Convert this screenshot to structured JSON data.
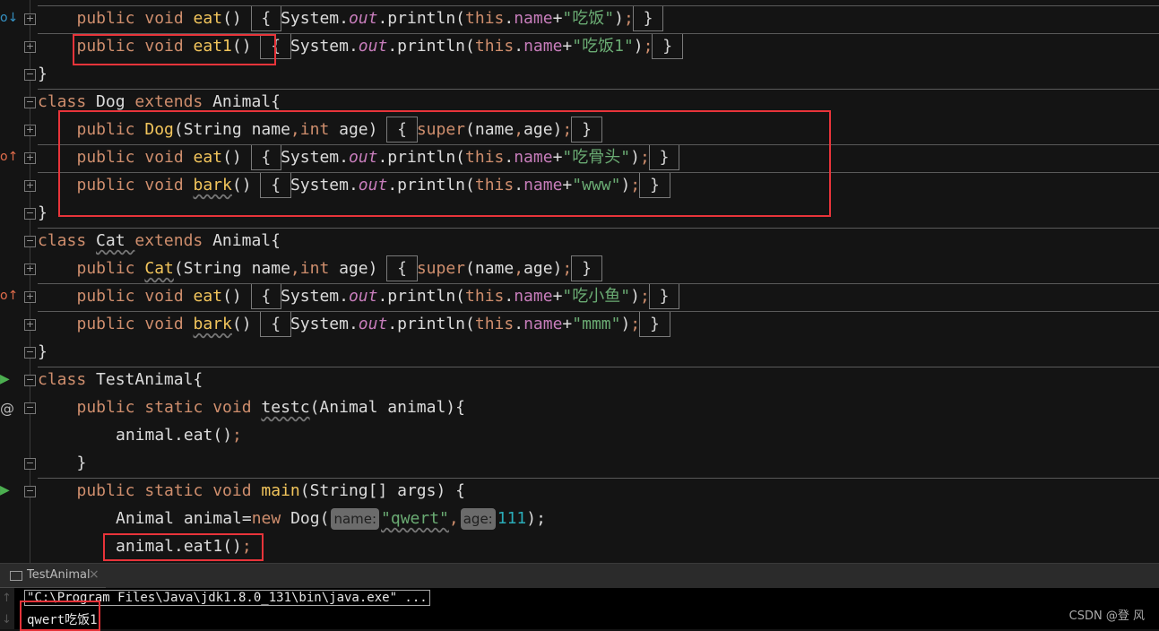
{
  "colors": {
    "accent_red": "#e8343a",
    "background": "#141414"
  },
  "code": {
    "lines": [
      {
        "indent": 1,
        "tokens": [
          [
            "public void ",
            "k"
          ],
          [
            "eat",
            "m"
          ],
          [
            "() ",
            "p"
          ],
          [
            " { ",
            "b"
          ],
          [
            "System.",
            "p"
          ],
          [
            "out",
            "f"
          ],
          [
            ".println(",
            "p"
          ],
          [
            "this",
            "t"
          ],
          [
            ".",
            "p"
          ],
          [
            "name",
            "n"
          ],
          [
            "+",
            "p"
          ],
          [
            "\"吃饭\"",
            "s"
          ],
          [
            ")",
            "p"
          ],
          [
            ";",
            "t"
          ],
          [
            " } ",
            "b"
          ]
        ]
      },
      {
        "indent": 1,
        "tokens": [
          [
            "public void ",
            "k"
          ],
          [
            "eat1",
            "m"
          ],
          [
            "() ",
            "p"
          ],
          [
            " { ",
            "b"
          ],
          [
            "System.",
            "p"
          ],
          [
            "out",
            "f"
          ],
          [
            ".println(",
            "p"
          ],
          [
            "this",
            "t"
          ],
          [
            ".",
            "p"
          ],
          [
            "name",
            "n"
          ],
          [
            "+",
            "p"
          ],
          [
            "\"吃饭1\"",
            "s"
          ],
          [
            ")",
            "p"
          ],
          [
            ";",
            "t"
          ],
          [
            " } ",
            "b"
          ]
        ]
      },
      {
        "indent": 0,
        "tokens": [
          [
            "}",
            "p"
          ]
        ]
      },
      {
        "indent": 0,
        "tokens": [
          [
            "class ",
            "k"
          ],
          [
            "Dog ",
            "p"
          ],
          [
            "extends ",
            "k"
          ],
          [
            "Animal{",
            "p"
          ]
        ]
      },
      {
        "indent": 1,
        "tokens": [
          [
            "public ",
            "k"
          ],
          [
            "Dog",
            "m"
          ],
          [
            "(String name",
            "p"
          ],
          [
            ",",
            "k"
          ],
          [
            "int ",
            "k"
          ],
          [
            "age) ",
            "p"
          ],
          [
            " { ",
            "b"
          ],
          [
            "super",
            "k"
          ],
          [
            "(name",
            "p"
          ],
          [
            ",",
            "k"
          ],
          [
            "age)",
            "p"
          ],
          [
            ";",
            "t"
          ],
          [
            " } ",
            "b"
          ]
        ]
      },
      {
        "indent": 1,
        "tokens": [
          [
            "public void ",
            "k"
          ],
          [
            "eat",
            "m"
          ],
          [
            "() ",
            "p"
          ],
          [
            " { ",
            "b"
          ],
          [
            "System.",
            "p"
          ],
          [
            "out",
            "f"
          ],
          [
            ".println(",
            "p"
          ],
          [
            "this",
            "t"
          ],
          [
            ".",
            "p"
          ],
          [
            "name",
            "n"
          ],
          [
            "+",
            "p"
          ],
          [
            "\"吃骨头\"",
            "s"
          ],
          [
            ")",
            "p"
          ],
          [
            ";",
            "t"
          ],
          [
            " } ",
            "b"
          ]
        ]
      },
      {
        "indent": 1,
        "tokens": [
          [
            "public void ",
            "k"
          ],
          [
            "bark",
            "m u"
          ],
          [
            "() ",
            "p"
          ],
          [
            " { ",
            "b"
          ],
          [
            "System.",
            "p"
          ],
          [
            "out",
            "f"
          ],
          [
            ".println(",
            "p"
          ],
          [
            "this",
            "t"
          ],
          [
            ".",
            "p"
          ],
          [
            "name",
            "n"
          ],
          [
            "+",
            "p"
          ],
          [
            "\"www\"",
            "s"
          ],
          [
            ")",
            "p"
          ],
          [
            ";",
            "t"
          ],
          [
            " } ",
            "b"
          ]
        ]
      },
      {
        "indent": 0,
        "tokens": [
          [
            "}",
            "p"
          ]
        ]
      },
      {
        "indent": 0,
        "tokens": [
          [
            "class ",
            "k"
          ],
          [
            "Cat ",
            "p u"
          ],
          [
            "extends ",
            "k"
          ],
          [
            "Animal{",
            "p"
          ]
        ]
      },
      {
        "indent": 1,
        "tokens": [
          [
            "public ",
            "k"
          ],
          [
            "Cat",
            "m u"
          ],
          [
            "(String name",
            "p"
          ],
          [
            ",",
            "k"
          ],
          [
            "int ",
            "k"
          ],
          [
            "age) ",
            "p"
          ],
          [
            " { ",
            "b"
          ],
          [
            "super",
            "k"
          ],
          [
            "(name",
            "p"
          ],
          [
            ",",
            "k"
          ],
          [
            "age)",
            "p"
          ],
          [
            ";",
            "t"
          ],
          [
            " } ",
            "b"
          ]
        ]
      },
      {
        "indent": 1,
        "tokens": [
          [
            "public void ",
            "k"
          ],
          [
            "eat",
            "m"
          ],
          [
            "() ",
            "p"
          ],
          [
            " { ",
            "b"
          ],
          [
            "System.",
            "p"
          ],
          [
            "out",
            "f"
          ],
          [
            ".println(",
            "p"
          ],
          [
            "this",
            "t"
          ],
          [
            ".",
            "p"
          ],
          [
            "name",
            "n"
          ],
          [
            "+",
            "p"
          ],
          [
            "\"吃小鱼\"",
            "s"
          ],
          [
            ")",
            "p"
          ],
          [
            ";",
            "t"
          ],
          [
            " } ",
            "b"
          ]
        ]
      },
      {
        "indent": 1,
        "tokens": [
          [
            "public void ",
            "k"
          ],
          [
            "bark",
            "m u"
          ],
          [
            "() ",
            "p"
          ],
          [
            " { ",
            "b"
          ],
          [
            "System.",
            "p"
          ],
          [
            "out",
            "f"
          ],
          [
            ".println(",
            "p"
          ],
          [
            "this",
            "t"
          ],
          [
            ".",
            "p"
          ],
          [
            "name",
            "n"
          ],
          [
            "+",
            "p"
          ],
          [
            "\"mmm\"",
            "s"
          ],
          [
            ")",
            "p"
          ],
          [
            ";",
            "t"
          ],
          [
            " } ",
            "b"
          ]
        ]
      },
      {
        "indent": 0,
        "tokens": [
          [
            "}",
            "p"
          ]
        ]
      },
      {
        "indent": 0,
        "tokens": [
          [
            "class ",
            "k"
          ],
          [
            "TestAnimal{",
            "p"
          ]
        ]
      },
      {
        "indent": 1,
        "tokens": [
          [
            "public static void ",
            "k"
          ],
          [
            "testc",
            "p u"
          ],
          [
            "(Animal animal){",
            "p"
          ]
        ]
      },
      {
        "indent": 2,
        "tokens": [
          [
            "animal.eat()",
            "p"
          ],
          [
            ";",
            "t"
          ]
        ]
      },
      {
        "indent": 1,
        "tokens": [
          [
            "}",
            "p"
          ]
        ]
      },
      {
        "indent": 1,
        "tokens": [
          [
            "public static void ",
            "k"
          ],
          [
            "main",
            "m"
          ],
          [
            "(String[] args) {",
            "p"
          ]
        ]
      },
      {
        "indent": 2,
        "tokens": [
          [
            "Animal animal=",
            "p"
          ],
          [
            "new ",
            "k"
          ],
          [
            "Dog(",
            "p"
          ],
          [
            "name:",
            "h"
          ],
          [
            "\"qwert\"",
            "s u"
          ],
          [
            ",",
            "k"
          ],
          [
            "age:",
            "h"
          ],
          [
            "111",
            "num"
          ],
          [
            ");",
            "p"
          ]
        ]
      },
      {
        "indent": 2,
        "tokens": [
          [
            "animal.eat1()",
            "p"
          ],
          [
            ";",
            "t"
          ]
        ]
      }
    ]
  },
  "gutter": {
    "overrides_icon": "o↓",
    "overridden_icon": "o↑",
    "run_icon": "▶",
    "at_icon": "@"
  },
  "run_panel": {
    "tab_label": "TestAnimal",
    "close_icon": "×",
    "command": "\"C:\\Program Files\\Java\\jdk1.8.0_131\\bin\\java.exe\" ...",
    "output": "qwert吃饭1",
    "up_icon": "↑",
    "down_icon": "↓"
  },
  "watermark": "CSDN @登 风"
}
